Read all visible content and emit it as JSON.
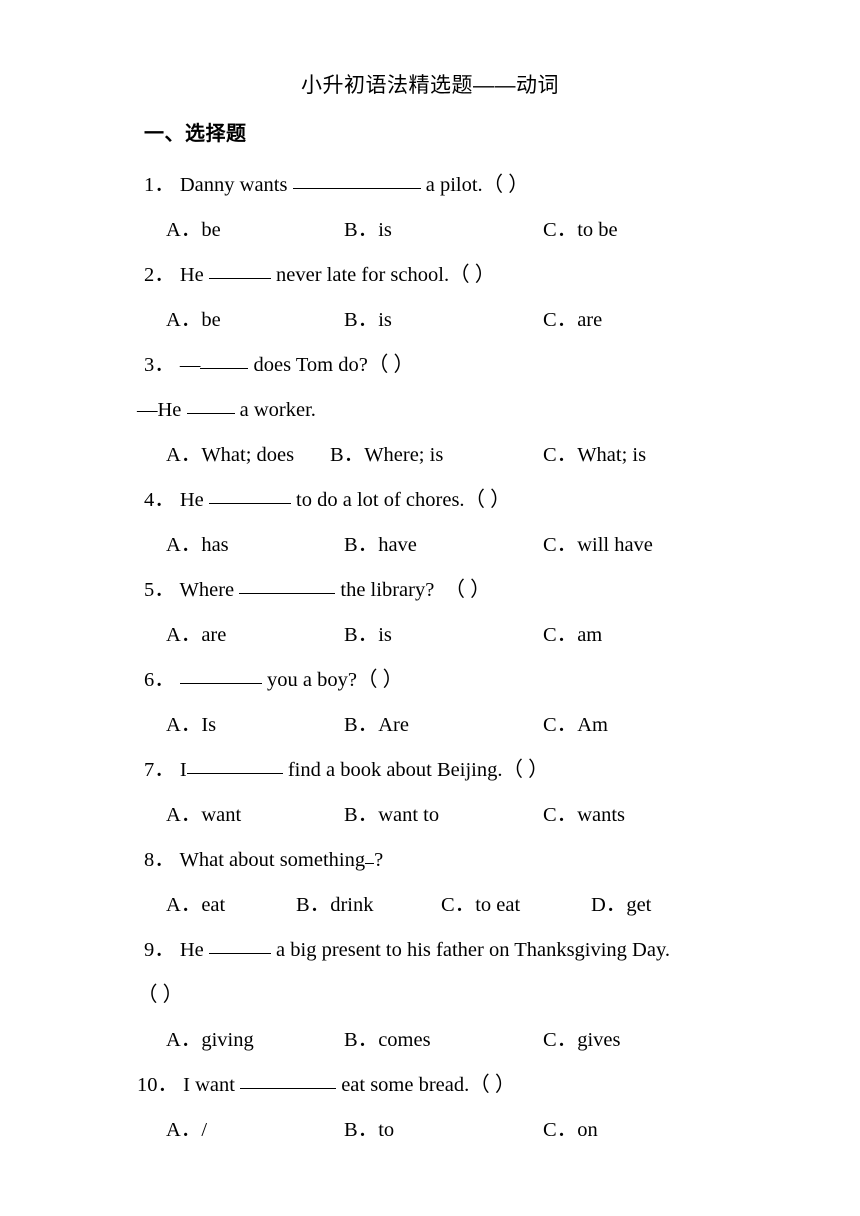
{
  "document": {
    "title": "小升初语法精选题——动词",
    "section_heading": "一、选择题"
  },
  "questions": [
    {
      "number": "1．",
      "stem_before": "Danny wants ",
      "blank": "xl",
      "stem_after": " a pilot.（  ）",
      "options_count": 3,
      "options": [
        {
          "label": "A．",
          "text": "be"
        },
        {
          "label": "B．",
          "text": "is"
        },
        {
          "label": "C．",
          "text": "to be"
        }
      ]
    },
    {
      "number": "2．",
      "stem_before": "He ",
      "blank": "sm",
      "stem_after": " never late for school.（ ）",
      "options_count": 3,
      "options": [
        {
          "label": "A．",
          "text": "be"
        },
        {
          "label": "B．",
          "text": "is"
        },
        {
          "label": "C．",
          "text": "are"
        }
      ]
    },
    {
      "number": "3．",
      "stem_before": "—",
      "blank": "xs",
      "stem_after": " does Tom do?（  ）",
      "continuation_before": "—He ",
      "continuation_blank": "xs",
      "continuation_after": " a worker.",
      "options_count": 3,
      "options": [
        {
          "label": "A．",
          "text": "What; does"
        },
        {
          "label": "B．",
          "text": "Where; is"
        },
        {
          "label": "C．",
          "text": "What; is"
        }
      ]
    },
    {
      "number": "4．",
      "stem_before": "He ",
      "blank": "md",
      "stem_after": " to do a lot of chores.（   ）",
      "options_count": 3,
      "options": [
        {
          "label": "A．",
          "text": "has"
        },
        {
          "label": "B．",
          "text": "have"
        },
        {
          "label": "C．",
          "text": "will have"
        }
      ]
    },
    {
      "number": "5．",
      "stem_before": "Where ",
      "blank": "lg",
      "stem_after": " the library?　（ ）",
      "options_count": 3,
      "options": [
        {
          "label": "A．",
          "text": "are"
        },
        {
          "label": "B．",
          "text": "is"
        },
        {
          "label": "C．",
          "text": "am"
        }
      ]
    },
    {
      "number": "6．",
      "stem_before": "  ",
      "blank": "md",
      "stem_after": " you a boy?（ ）",
      "options_count": 3,
      "options": [
        {
          "label": "A．",
          "text": "Is"
        },
        {
          "label": "B．",
          "text": "Are"
        },
        {
          "label": "C．",
          "text": "Am"
        }
      ]
    },
    {
      "number": "7．",
      "stem_before": "I",
      "blank": "lg",
      "stem_after": " find a book about Beijing.（   ）",
      "options_count": 3,
      "options": [
        {
          "label": "A．",
          "text": "want"
        },
        {
          "label": "B．",
          "text": "want to"
        },
        {
          "label": "C．",
          "text": "wants"
        }
      ]
    },
    {
      "number": "8．",
      "stem_before": "What about something",
      "blank": "tiny",
      "stem_after": "?",
      "options_count": 4,
      "options": [
        {
          "label": "A．",
          "text": "eat"
        },
        {
          "label": "B．",
          "text": "drink"
        },
        {
          "label": "C．",
          "text": "to eat"
        },
        {
          "label": "D．",
          "text": "get"
        }
      ]
    },
    {
      "number": "9．",
      "stem_before": "He ",
      "blank": "sm",
      "stem_after": " a big present to his father on Thanksgiving Day.",
      "wrap_line": "（ ）",
      "options_count": 3,
      "options": [
        {
          "label": "A．",
          "text": "giving"
        },
        {
          "label": "B．",
          "text": "comes"
        },
        {
          "label": "C．",
          "text": "gives"
        }
      ]
    },
    {
      "number": "10．",
      "stem_before": "I want ",
      "blank": "lg",
      "stem_after": " eat some bread.（    ）",
      "options_count": 3,
      "options": [
        {
          "label": "A．",
          "text": "/"
        },
        {
          "label": "B．",
          "text": "to"
        },
        {
          "label": "C．",
          "text": "on"
        }
      ]
    }
  ]
}
